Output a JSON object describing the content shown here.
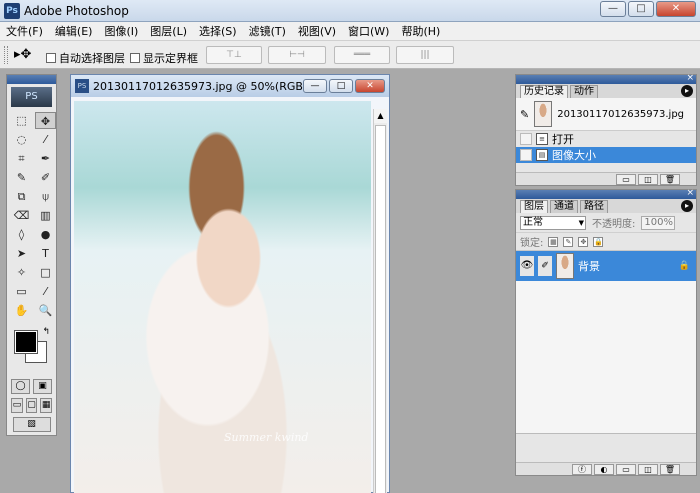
{
  "app": {
    "title": "Adobe Photoshop",
    "logo_text": "Ps"
  },
  "window_buttons": {
    "minimize": "—",
    "maximize": "□",
    "close": "✕"
  },
  "menu": [
    "文件(F)",
    "编辑(E)",
    "图像(I)",
    "图层(L)",
    "选择(S)",
    "滤镜(T)",
    "视图(V)",
    "窗口(W)",
    "帮助(H)"
  ],
  "options_bar": {
    "move_icon": "▸✥",
    "auto_select_label": "自动选择图层",
    "show_bounds_label": "显示定界框",
    "align_buttons": [
      "⊤⊥",
      "⊢⊣",
      "═══",
      "|||"
    ]
  },
  "toolbox": {
    "logo_text": "PS",
    "tools": [
      "⬚",
      "✥",
      "◌",
      "⁄",
      "⌗",
      "✒",
      "✎",
      "✐",
      "⧉",
      "⍦",
      "⌫",
      "▥",
      "◊",
      "●",
      "➤",
      "T",
      "✧",
      "□",
      "▭",
      "⁄",
      "✋",
      "🔍"
    ],
    "swap_icon": "↰",
    "mode_buttons": [
      "◯",
      "▣",
      "▭",
      "▢",
      "▦",
      "▧"
    ]
  },
  "document": {
    "title": "20130117012635973.jpg @ 50%(RGB)",
    "icon_text": "PS",
    "buttons": {
      "minimize": "—",
      "maximize": "□",
      "close": "✕"
    },
    "watermark": "Summer  kwind"
  },
  "history_panel": {
    "tabs": [
      "历史记录",
      "动作"
    ],
    "snapshot_name": "20130117012635973.jpg",
    "items": [
      {
        "label": "打开",
        "selected": false
      },
      {
        "label": "图像大小",
        "selected": true
      }
    ],
    "footer_buttons": [
      "▭",
      "◫",
      "🗑"
    ]
  },
  "layers_panel": {
    "tabs": [
      "图层",
      "通道",
      "路径"
    ],
    "blend_mode": "正常",
    "opacity_label": "不透明度:",
    "opacity_value": "100%",
    "lock_label": "锁定:",
    "layers": [
      {
        "name": "背景",
        "selected": true,
        "locked": true
      }
    ],
    "footer_buttons": [
      "ⓕ",
      "◐",
      "▭",
      "◫",
      "🗑"
    ]
  },
  "colors": {
    "accent": "#3b88d9",
    "foreground": "#000000",
    "background": "#ffffff"
  }
}
